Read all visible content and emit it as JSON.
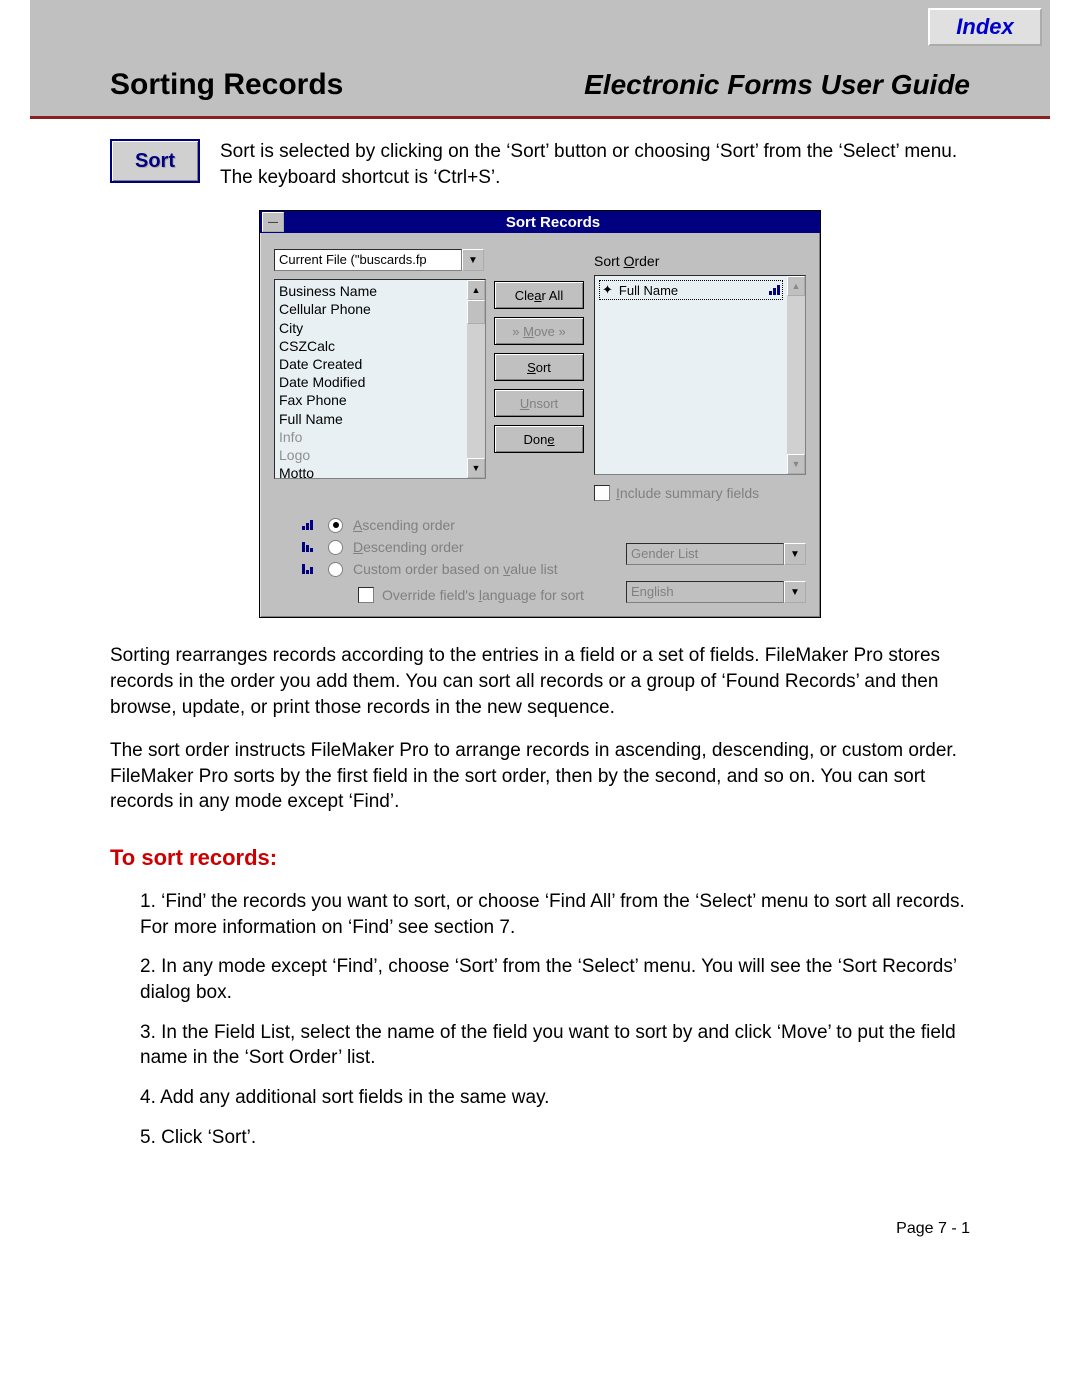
{
  "index_label": "Index",
  "header": {
    "left": "Sorting Records",
    "right": "Electronic Forms User Guide"
  },
  "sort_button_label": "Sort",
  "intro_text": "Sort is selected by clicking on the ‘Sort’ button or choosing ‘Sort’ from the ‘Select’ menu. The keyboard shortcut is ‘Ctrl+S’.",
  "dialog": {
    "title": "Sort Records",
    "current_file": "Current File (\"buscards.fp",
    "field_list": [
      {
        "label": "Business Name",
        "dim": false
      },
      {
        "label": "Cellular Phone",
        "dim": false
      },
      {
        "label": "City",
        "dim": false
      },
      {
        "label": "CSZCalc",
        "dim": false
      },
      {
        "label": "Date Created",
        "dim": false
      },
      {
        "label": "Date Modified",
        "dim": false
      },
      {
        "label": "Fax Phone",
        "dim": false
      },
      {
        "label": "Full Name",
        "dim": false
      },
      {
        "label": "Info",
        "dim": true
      },
      {
        "label": "Logo",
        "dim": true
      },
      {
        "label": "Motto",
        "dim": false
      }
    ],
    "buttons": {
      "clear_all": "Clear All",
      "move": "» Move »",
      "sort": "Sort",
      "unsort": "Unsort",
      "done": "Done"
    },
    "sort_order_label": "Sort Order",
    "sort_order_items": [
      "Full Name"
    ],
    "include_summary": "Include summary fields",
    "radios": {
      "ascending": "Ascending order",
      "descending": "Descending order",
      "custom": "Custom order based on value list"
    },
    "override": "Override field's language for sort",
    "gender_list": "Gender List",
    "language": "English"
  },
  "para1": "Sorting rearranges records according to the entries in a field or a set of fields. FileMaker Pro stores records in the order you add them. You can sort all records or a group of ‘Found Records’ and then browse, update, or print those records in the new sequence.",
  "para2": "The sort order instructs FileMaker Pro to arrange records in ascending, descending, or custom order. FileMaker Pro sorts by the first field in the sort order, then by the second, and so on. You can sort records in any mode except ‘Find’.",
  "section_head": "To sort records:",
  "steps": [
    "1.  ‘Find’ the records you want to sort, or choose ‘Find All’ from the ‘Select’ menu to sort all records. For more information on ‘Find’ see section 7.",
    "2.  In any mode except ‘Find’, choose ‘Sort’ from the ‘Select’ menu. You will see the ‘Sort Records’ dialog box.",
    "3.  In the Field List, select the name of the field you want to sort by and click ‘Move’ to put the field name in the ‘Sort Order’ list.",
    "4.  Add any additional sort fields in the same way.",
    "5.  Click ‘Sort’."
  ],
  "page_foot": "Page  7 - 1"
}
